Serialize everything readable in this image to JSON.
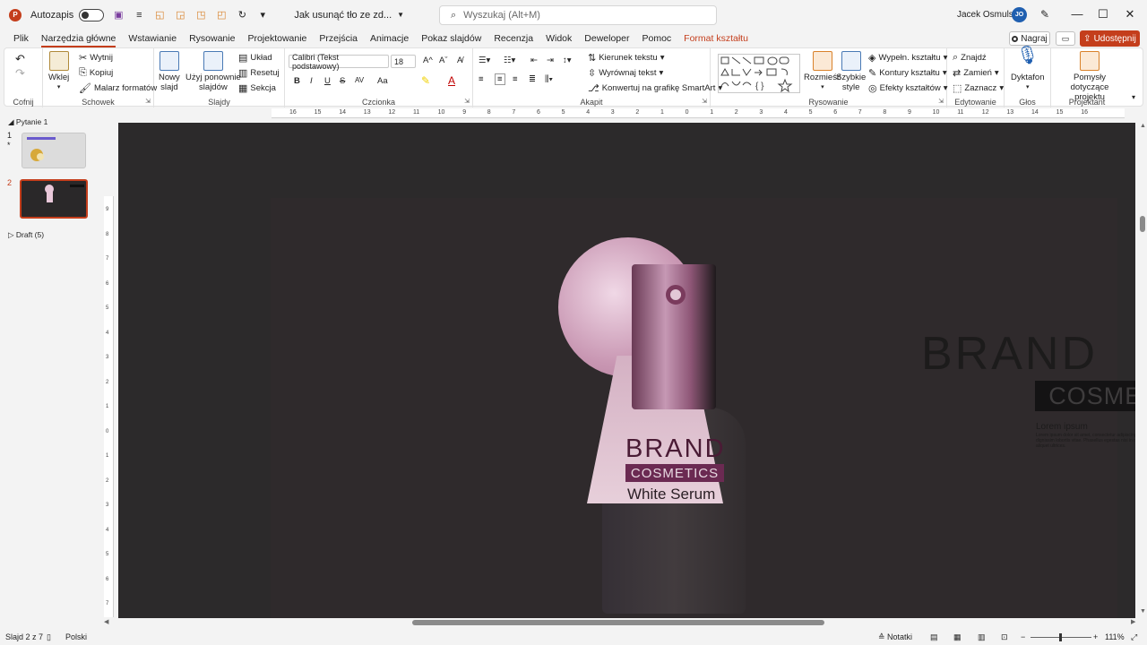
{
  "titlebar": {
    "autosave_label": "Autozapis",
    "doc_title": "Jak usunąć tło ze zd...",
    "search_placeholder": "Wyszukaj (Alt+M)",
    "user_name": "Jacek Osmulski",
    "user_initials": "JO"
  },
  "menu": {
    "tabs": [
      "Plik",
      "Narzędzia główne",
      "Wstawianie",
      "Rysowanie",
      "Projektowanie",
      "Przejścia",
      "Animacje",
      "Pokaz slajdów",
      "Recenzja",
      "Widok",
      "Deweloper",
      "Pomoc"
    ],
    "context_tab": "Format kształtu",
    "record_label": "Nagraj",
    "share_label": "Udostępnij"
  },
  "ribbon": {
    "undo_group": "Cofnij",
    "clipboard": {
      "label": "Schowek",
      "paste": "Wklej",
      "cut": "Wytnij",
      "copy": "Kopiuj",
      "painter": "Malarz formatów"
    },
    "slides": {
      "label": "Slajdy",
      "new_slide_1": "Nowy",
      "new_slide_2": "slajd",
      "reuse_1": "Użyj ponownie",
      "reuse_2": "slajdów",
      "layout": "Układ",
      "reset": "Resetuj",
      "section": "Sekcja"
    },
    "font": {
      "label": "Czcionka",
      "family": "Calibri (Tekst podstawowy)",
      "size": "18",
      "bold": "B",
      "italic": "I",
      "underline": "U",
      "strike": "S",
      "spacing": "AV",
      "case": "Aa"
    },
    "paragraph": {
      "label": "Akapit",
      "direction": "Kierunek tekstu",
      "align": "Wyrównaj tekst",
      "smartart": "Konwertuj na grafikę SmartArt"
    },
    "drawing": {
      "label": "Rysowanie",
      "arrange_1": "Rozmieść",
      "quick_1": "Szybkie",
      "quick_2": "style",
      "fill": "Wypełn. kształtu",
      "outline": "Kontury kształtu",
      "effects": "Efekty kształtów"
    },
    "editing": {
      "label": "Edytowanie",
      "find": "Znajdź",
      "replace": "Zamień",
      "select": "Zaznacz"
    },
    "voice": {
      "label": "Głos",
      "dictate": "Dyktafon"
    },
    "designer": {
      "label": "Projektant",
      "ideas_1": "Pomysły",
      "ideas_2": "dotyczące projektu"
    }
  },
  "left_pane": {
    "section_1": "Pytanie 1",
    "slide_1_num": "1",
    "slide_1_star": "*",
    "slide_2_num": "2",
    "section_2": "Draft (5)"
  },
  "ruler": {
    "h_ticks": [
      "16",
      "15",
      "14",
      "13",
      "12",
      "11",
      "10",
      "9",
      "8",
      "7",
      "6",
      "5",
      "4",
      "3",
      "2",
      "1",
      "0",
      "1",
      "2",
      "3",
      "4",
      "5",
      "6",
      "7",
      "8",
      "9",
      "10",
      "11",
      "12",
      "13",
      "14",
      "15",
      "16"
    ],
    "v_ticks": [
      "9",
      "8",
      "7",
      "6",
      "5",
      "4",
      "3",
      "2",
      "1",
      "0",
      "1",
      "2",
      "3",
      "4",
      "5",
      "6",
      "7"
    ]
  },
  "slide": {
    "brand_title": "BRAND",
    "brand_sub": "COSMETICS",
    "lorem_title": "Lorem ipsum",
    "lorem_body": "Lorem ipsum dolor sit amet, consectetur adipiscing elit. Sed quis tempus erat, sed vulputa dignissim lobortis vitae. Phasellus egestas nisi in rutrum. Vivamus euismod, massa vel risus aliquet ultrices.",
    "product_brand": "BRAND",
    "product_cosmetics": "COSMETICS",
    "product_name": "White Serum"
  },
  "status": {
    "slide_info": "Slajd 2 z 7",
    "language": "Polski",
    "notes": "Notatki",
    "zoom": "111%"
  },
  "colors": {
    "accent": "#c43e1c",
    "canvas": "#2c2a2b",
    "magenta": "#6b2a52"
  }
}
